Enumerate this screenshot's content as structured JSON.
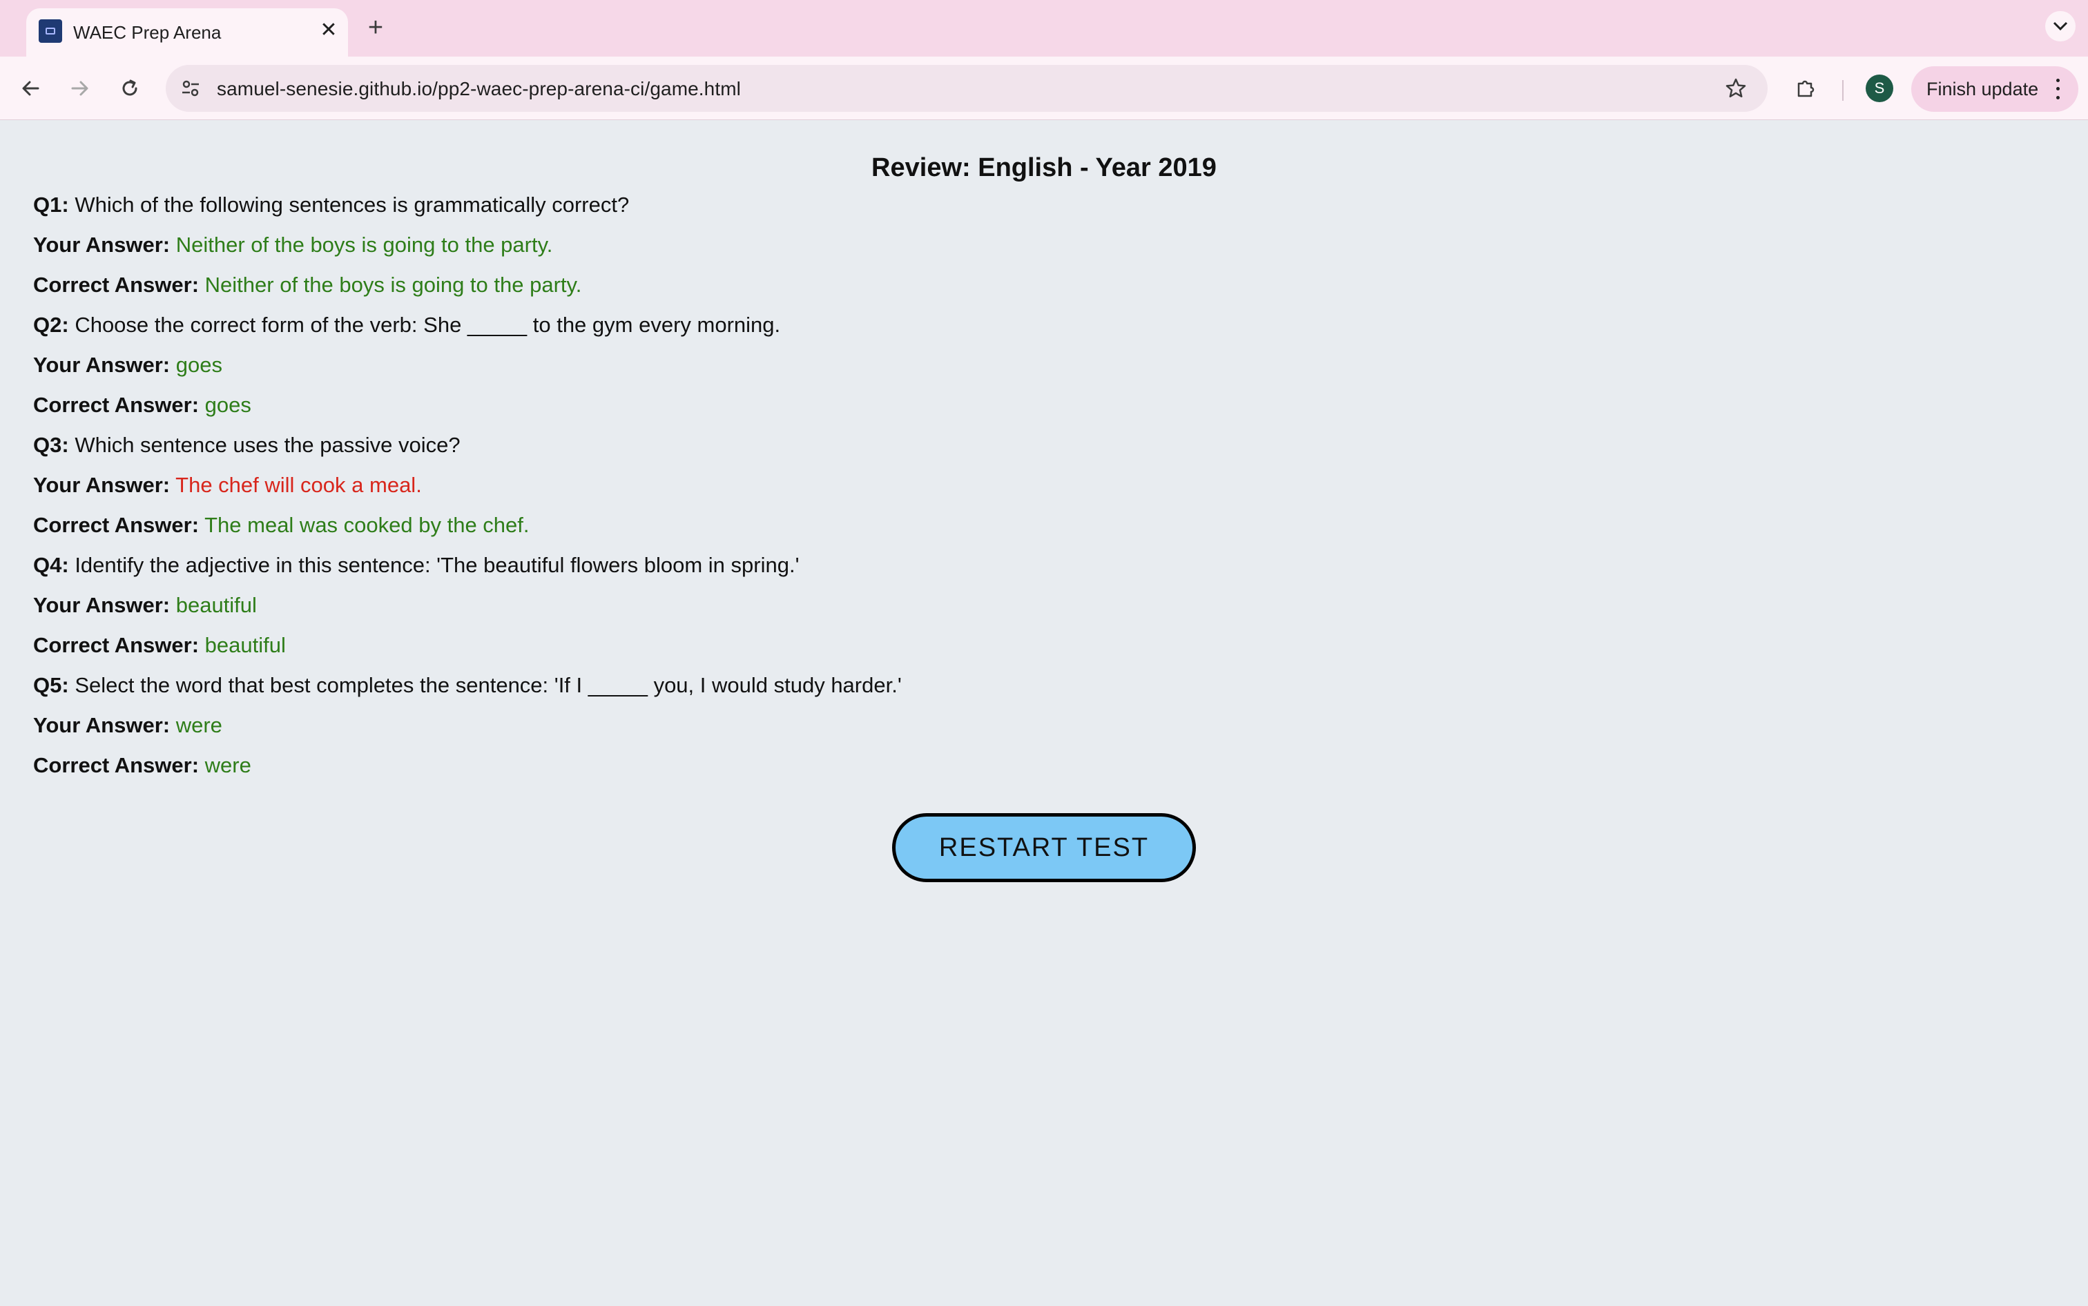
{
  "browser": {
    "tab_title": "WAEC Prep Arena",
    "tab_close": "✕",
    "new_tab": "+",
    "url": "samuel-senesie.github.io/pp2-waec-prep-arena-ci/game.html",
    "avatar_letter": "S",
    "finish_update_label": "Finish update"
  },
  "page": {
    "title": "Review: English - Year 2019",
    "restart_label": "RESTART TEST",
    "labels": {
      "your_answer": "Your Answer:",
      "correct_answer": "Correct Answer:"
    },
    "questions": [
      {
        "number": "Q1:",
        "text": "Which of the following sentences is grammatically correct?",
        "your_answer": "Neither of the boys is going to the party.",
        "correct_answer": "Neither of the boys is going to the party.",
        "is_correct": true
      },
      {
        "number": "Q2:",
        "text": "Choose the correct form of the verb: She _____ to the gym every morning.",
        "your_answer": "goes",
        "correct_answer": "goes",
        "is_correct": true
      },
      {
        "number": "Q3:",
        "text": "Which sentence uses the passive voice?",
        "your_answer": "The chef will cook a meal.",
        "correct_answer": "The meal was cooked by the chef.",
        "is_correct": false
      },
      {
        "number": "Q4:",
        "text": "Identify the adjective in this sentence: 'The beautiful flowers bloom in spring.'",
        "your_answer": "beautiful",
        "correct_answer": "beautiful",
        "is_correct": true
      },
      {
        "number": "Q5:",
        "text": "Select the word that best completes the sentence: 'If I _____ you, I would study harder.'",
        "your_answer": "were",
        "correct_answer": "were",
        "is_correct": true
      }
    ]
  },
  "colors": {
    "correct": "#2e7d19",
    "incorrect": "#d8261c",
    "button": "#7cc8f5",
    "background": "#e8ecf0"
  }
}
